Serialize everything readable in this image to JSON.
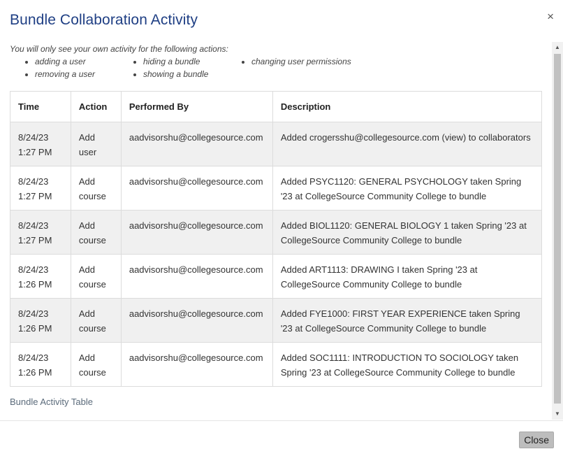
{
  "modal": {
    "title": "Bundle Collaboration Activity",
    "close_icon": "×"
  },
  "notice": {
    "intro": "You will only see your own activity for the following actions:",
    "items": [
      "adding a user",
      "hiding a bundle",
      "changing user permissions",
      "removing a user",
      "showing a bundle"
    ]
  },
  "table": {
    "columns": [
      "Time",
      "Action",
      "Performed By",
      "Description"
    ],
    "rows": [
      {
        "time": "8/24/23\n1:27 PM",
        "action": "Add\nuser",
        "by": "aadvisorshu@collegesource.com",
        "description": "Added crogersshu@collegesource.com (view) to collaborators"
      },
      {
        "time": "8/24/23\n1:27 PM",
        "action": "Add\ncourse",
        "by": "aadvisorshu@collegesource.com",
        "description": "Added PSYC1120: GENERAL PSYCHOLOGY taken Spring '23 at CollegeSource Community College to bundle"
      },
      {
        "time": "8/24/23\n1:27 PM",
        "action": "Add\ncourse",
        "by": "aadvisorshu@collegesource.com",
        "description": "Added BIOL1120: GENERAL BIOLOGY 1 taken Spring '23 at CollegeSource Community College to bundle"
      },
      {
        "time": "8/24/23\n1:26 PM",
        "action": "Add\ncourse",
        "by": "aadvisorshu@collegesource.com",
        "description": "Added ART1113: DRAWING I taken Spring '23 at CollegeSource Community College to bundle"
      },
      {
        "time": "8/24/23\n1:26 PM",
        "action": "Add\ncourse",
        "by": "aadvisorshu@collegesource.com",
        "description": "Added FYE1000: FIRST YEAR EXPERIENCE taken Spring '23 at CollegeSource Community College to bundle"
      },
      {
        "time": "8/24/23\n1:26 PM",
        "action": "Add\ncourse",
        "by": "aadvisorshu@collegesource.com",
        "description": "Added SOC1111: INTRODUCTION TO SOCIOLOGY taken Spring '23 at CollegeSource Community College to bundle"
      }
    ],
    "caption": "Bundle Activity Table"
  },
  "scrollbar": {
    "up_icon": "▲",
    "down_icon": "▼"
  },
  "footer": {
    "close_label": "Close"
  }
}
